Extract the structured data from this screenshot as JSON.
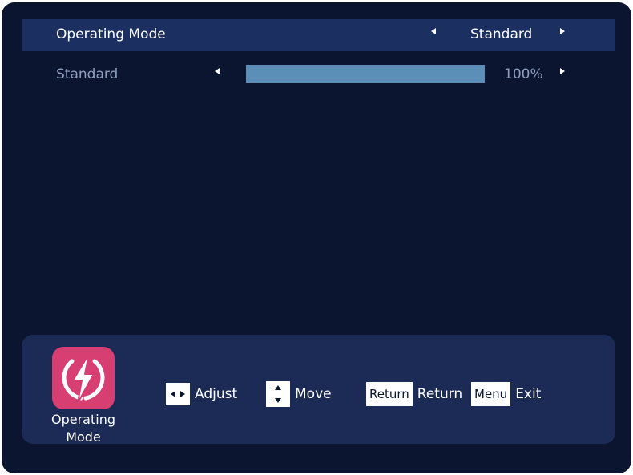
{
  "menu": {
    "operating_mode": {
      "label": "Operating Mode",
      "value": "Standard"
    },
    "standard": {
      "label": "Standard",
      "level_percent": 100,
      "value_text": "100%"
    }
  },
  "footer": {
    "section": {
      "icon": "lightning-bolt-icon",
      "caption": "Operating Mode",
      "icon_color": "#d73e72"
    },
    "hints": {
      "adjust": "Adjust",
      "move": "Move",
      "return_key": "Return",
      "return_label": "Return",
      "menu_key": "Menu",
      "exit_label": "Exit"
    }
  },
  "colors": {
    "background": "#0b1530",
    "selected_row": "#1b2f60",
    "footer": "#1b2b56",
    "bar_fill": "#5c8fb8"
  }
}
